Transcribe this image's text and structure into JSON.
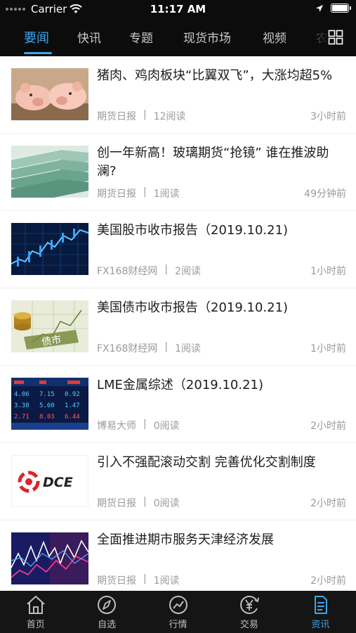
{
  "status_bar": {
    "carrier": "Carrier",
    "time": "11:17 AM"
  },
  "tabs": [
    {
      "label": "要闻",
      "active": true
    },
    {
      "label": "快讯"
    },
    {
      "label": "专题"
    },
    {
      "label": "现货市场"
    },
    {
      "label": "视频"
    },
    {
      "label": "农"
    }
  ],
  "news": [
    {
      "title": "猪肉、鸡肉板块“比翼双飞”，大涨均超5%",
      "source": "期货日报",
      "reads": "12阅读",
      "time_ago": "3小时前",
      "thumb": "pigs"
    },
    {
      "title": "创一年新高！玻璃期货“抢镜” 谁在推波助澜?",
      "source": "期货日报",
      "reads": "1阅读",
      "time_ago": "49分钟前",
      "thumb": "glass"
    },
    {
      "title": "美国股市收市报告（2019.10.21)",
      "source": "FX168财经网",
      "reads": "2阅读",
      "time_ago": "1小时前",
      "thumb": "stock-chart"
    },
    {
      "title": "美国债市收市报告（2019.10.21)",
      "source": "FX168财经网",
      "reads": "1阅读",
      "time_ago": "1小时前",
      "thumb": "bond-coins"
    },
    {
      "title": "LME金属综述（2019.10.21)",
      "source": "博易大师",
      "reads": "0阅读",
      "time_ago": "2小时前",
      "thumb": "metal-board"
    },
    {
      "title": "引入不强配滚动交割 完善优化交割制度",
      "source": "期货日报",
      "reads": "0阅读",
      "time_ago": "2小时前",
      "thumb": "dce-logo",
      "logo_text": "DCE"
    },
    {
      "title": "全面推进期市服务天津经济发展",
      "source": "期货日报",
      "reads": "1阅读",
      "time_ago": "2小时前",
      "thumb": "chart-lines"
    }
  ],
  "bottom_nav": [
    {
      "label": "首页",
      "icon": "home-icon"
    },
    {
      "label": "自选",
      "icon": "compass-icon"
    },
    {
      "label": "行情",
      "icon": "trend-icon"
    },
    {
      "label": "交易",
      "icon": "yen-icon"
    },
    {
      "label": "资讯",
      "icon": "document-icon",
      "active": true
    }
  ],
  "colors": {
    "accent": "#3da5e8",
    "bar_bg": "#0c0c0c"
  }
}
